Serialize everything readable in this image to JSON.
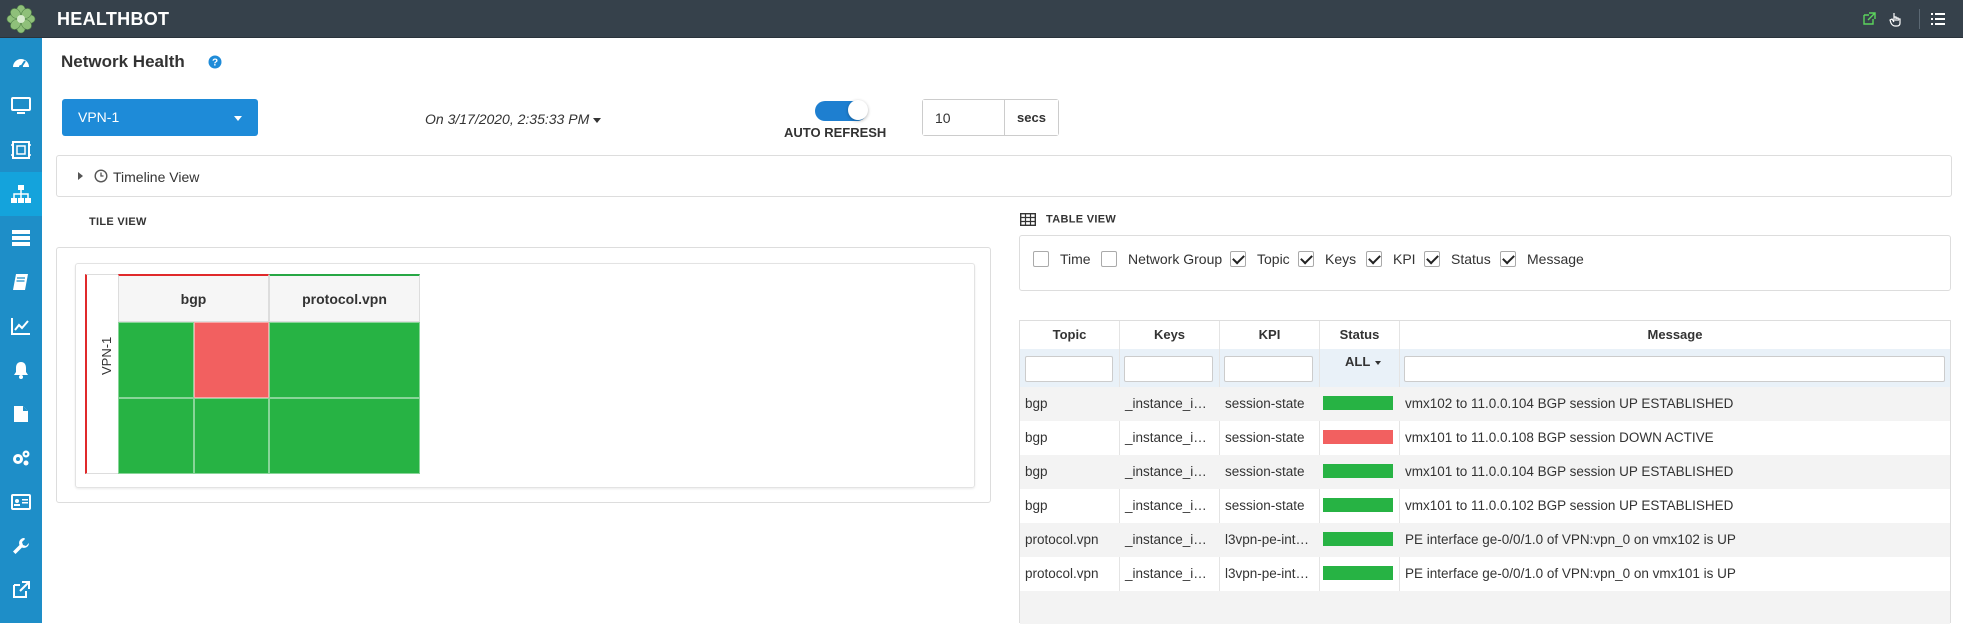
{
  "app": {
    "title": "HEALTHBOT"
  },
  "colors": {
    "accent": "#1e8bd8",
    "sidebar": "#1e8ec8",
    "ok": "#27b344",
    "fail": "#f26060",
    "topbar": "#36414b"
  },
  "sidebar": {
    "items": [
      {
        "icon": "dashboard-icon"
      },
      {
        "icon": "monitor-icon"
      },
      {
        "icon": "device-frame-icon"
      },
      {
        "icon": "network-tree-icon",
        "active": true
      },
      {
        "icon": "server-stack-icon"
      },
      {
        "icon": "book-icon"
      },
      {
        "icon": "chart-line-icon"
      },
      {
        "icon": "bell-icon"
      },
      {
        "icon": "file-icon"
      },
      {
        "icon": "gears-icon"
      },
      {
        "icon": "id-card-icon"
      },
      {
        "icon": "wrench-icon"
      },
      {
        "icon": "external-link-icon"
      }
    ]
  },
  "header": {
    "title": "Network Health"
  },
  "controls": {
    "group_select": "VPN-1",
    "time_select": "On 3/17/2020, 2:35:33 PM",
    "auto_refresh_label": "AUTO REFRESH",
    "auto_refresh_on": true,
    "interval_value": "10",
    "interval_unit": "secs"
  },
  "timeline": {
    "label": "Timeline View"
  },
  "tile_view": {
    "heading": "TILE VIEW",
    "row_label": "VPN-1",
    "columns": [
      {
        "label": "bgp",
        "cells": [
          "ok",
          "fail",
          "ok",
          "ok"
        ]
      },
      {
        "label": "protocol.vpn",
        "cells": [
          "ok",
          "ok"
        ]
      }
    ]
  },
  "table_view": {
    "heading": "TABLE VIEW",
    "column_toggles": [
      {
        "label": "Time",
        "checked": false
      },
      {
        "label": "Network Group",
        "checked": false
      },
      {
        "label": "Topic",
        "checked": true
      },
      {
        "label": "Keys",
        "checked": true
      },
      {
        "label": "KPI",
        "checked": true
      },
      {
        "label": "Status",
        "checked": true
      },
      {
        "label": "Message",
        "checked": true
      }
    ],
    "headers": {
      "topic": "Topic",
      "keys": "Keys",
      "kpi": "KPI",
      "status": "Status",
      "message": "Message"
    },
    "status_filter": "ALL",
    "rows": [
      {
        "topic": "bgp",
        "keys": "_instance_i…",
        "kpi": "session-state",
        "status": "ok",
        "message": "vmx102 to 11.0.0.104 BGP session UP ESTABLISHED"
      },
      {
        "topic": "bgp",
        "keys": "_instance_i…",
        "kpi": "session-state",
        "status": "fail",
        "message": "vmx101 to 11.0.0.108 BGP session DOWN ACTIVE"
      },
      {
        "topic": "bgp",
        "keys": "_instance_i…",
        "kpi": "session-state",
        "status": "ok",
        "message": "vmx101 to 11.0.0.104 BGP session UP ESTABLISHED"
      },
      {
        "topic": "bgp",
        "keys": "_instance_i…",
        "kpi": "session-state",
        "status": "ok",
        "message": "vmx101 to 11.0.0.102 BGP session UP ESTABLISHED"
      },
      {
        "topic": "protocol.vpn",
        "keys": "_instance_i…",
        "kpi": "l3vpn-pe-int…",
        "status": "ok",
        "message": "PE interface ge-0/0/1.0 of VPN:vpn_0 on vmx102 is UP"
      },
      {
        "topic": "protocol.vpn",
        "keys": "_instance_i…",
        "kpi": "l3vpn-pe-int…",
        "status": "ok",
        "message": "PE interface ge-0/0/1.0 of VPN:vpn_0 on vmx101 is UP"
      }
    ]
  }
}
